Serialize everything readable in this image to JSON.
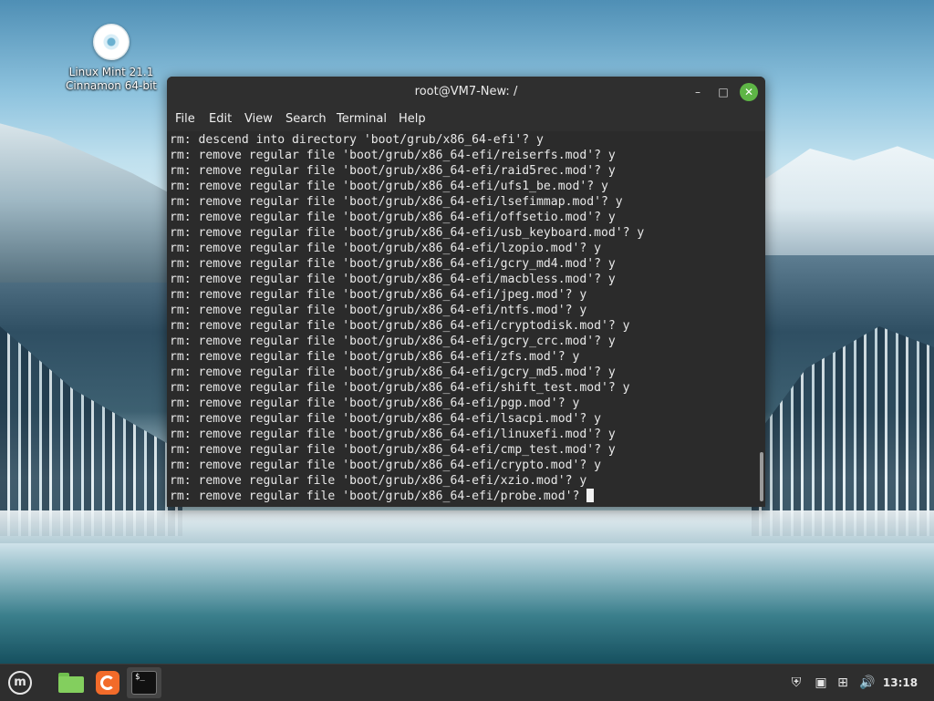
{
  "desktop": {
    "icons": [
      {
        "label": "Linux Mint 21.1 Cinnamon 64-bit",
        "icon": "disc-icon"
      }
    ]
  },
  "window": {
    "title": "root@VM7-New: /",
    "controls": {
      "minimize": "–",
      "maximize": "□",
      "close": "✕"
    },
    "menu": [
      "File",
      "Edit",
      "View",
      "Search",
      "Terminal",
      "Help"
    ]
  },
  "terminal": {
    "lines": [
      "rm: descend into directory 'boot/grub/x86_64-efi'? y",
      "rm: remove regular file 'boot/grub/x86_64-efi/reiserfs.mod'? y",
      "rm: remove regular file 'boot/grub/x86_64-efi/raid5rec.mod'? y",
      "rm: remove regular file 'boot/grub/x86_64-efi/ufs1_be.mod'? y",
      "rm: remove regular file 'boot/grub/x86_64-efi/lsefimmap.mod'? y",
      "rm: remove regular file 'boot/grub/x86_64-efi/offsetio.mod'? y",
      "rm: remove regular file 'boot/grub/x86_64-efi/usb_keyboard.mod'? y",
      "rm: remove regular file 'boot/grub/x86_64-efi/lzopio.mod'? y",
      "rm: remove regular file 'boot/grub/x86_64-efi/gcry_md4.mod'? y",
      "rm: remove regular file 'boot/grub/x86_64-efi/macbless.mod'? y",
      "rm: remove regular file 'boot/grub/x86_64-efi/jpeg.mod'? y",
      "rm: remove regular file 'boot/grub/x86_64-efi/ntfs.mod'? y",
      "rm: remove regular file 'boot/grub/x86_64-efi/cryptodisk.mod'? y",
      "rm: remove regular file 'boot/grub/x86_64-efi/gcry_crc.mod'? y",
      "rm: remove regular file 'boot/grub/x86_64-efi/zfs.mod'? y",
      "rm: remove regular file 'boot/grub/x86_64-efi/gcry_md5.mod'? y",
      "rm: remove regular file 'boot/grub/x86_64-efi/shift_test.mod'? y",
      "rm: remove regular file 'boot/grub/x86_64-efi/pgp.mod'? y",
      "rm: remove regular file 'boot/grub/x86_64-efi/lsacpi.mod'? y",
      "rm: remove regular file 'boot/grub/x86_64-efi/linuxefi.mod'? y",
      "rm: remove regular file 'boot/grub/x86_64-efi/cmp_test.mod'? y",
      "rm: remove regular file 'boot/grub/x86_64-efi/crypto.mod'? y",
      "rm: remove regular file 'boot/grub/x86_64-efi/xzio.mod'? y"
    ],
    "prompt_line": "rm: remove regular file 'boot/grub/x86_64-efi/probe.mod'?"
  },
  "taskbar": {
    "menu_glyph": "m",
    "apps": [
      "mint-menu-icon",
      "files-icon",
      "firefox-icon",
      "terminal-icon"
    ],
    "terminal_icon_text": "$_",
    "tray": {
      "shield": "⛨",
      "update": "▣",
      "network": "⊞",
      "volume": "🔊",
      "clock": "13:18"
    }
  },
  "colors": {
    "terminal_bg": "#2b2b2b",
    "titlebar_bg": "#2f2f2f",
    "close_button": "#5eb546",
    "taskbar_bg": "#2e2e2e"
  }
}
